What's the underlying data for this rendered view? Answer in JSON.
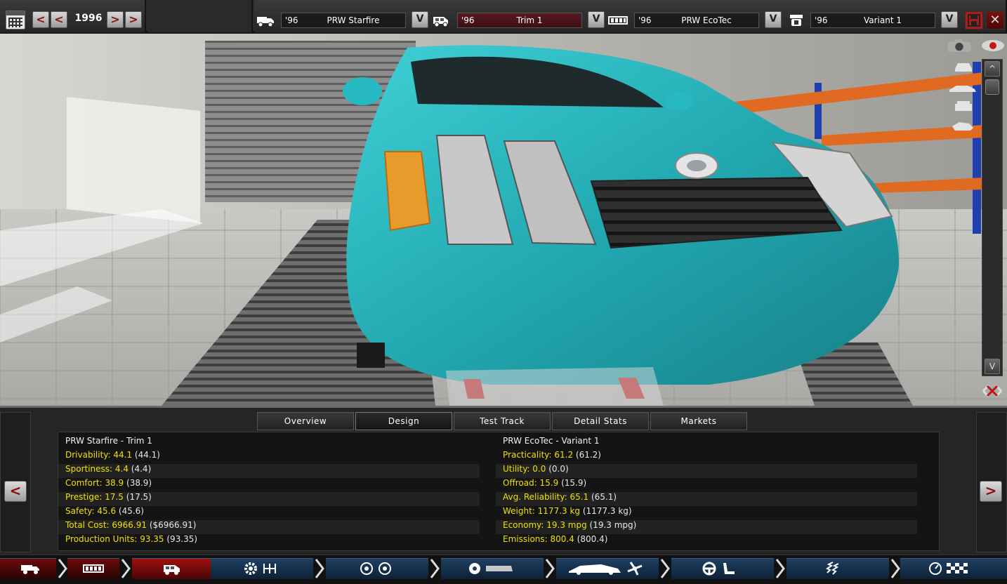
{
  "topbar": {
    "year": "1996",
    "prev_label": "<",
    "next_label": ">",
    "dropdown_label": "V",
    "selectors": [
      {
        "year": "'96",
        "name": "PRW Starfire"
      },
      {
        "year": "'96",
        "name": "Trim 1"
      },
      {
        "year": "'96",
        "name": "PRW EcoTec"
      },
      {
        "year": "'96",
        "name": "Variant 1"
      }
    ],
    "close_label": "✕"
  },
  "viewport": {
    "car_color": "#2ab0b8",
    "scroll_up": "^",
    "scroll_down": "V"
  },
  "tabs": [
    {
      "label": "Overview"
    },
    {
      "label": "Design"
    },
    {
      "label": "Test Track"
    },
    {
      "label": "Detail Stats"
    },
    {
      "label": "Markets"
    }
  ],
  "panel": {
    "prev_label": "<",
    "next_label": ">",
    "left_title": "PRW Starfire - Trim 1",
    "right_title": "PRW EcoTec - Variant 1",
    "left_stats": [
      {
        "label": "Drivability: 44.1",
        "value": " (44.1)"
      },
      {
        "label": "Sportiness: 4.4",
        "value": " (4.4)"
      },
      {
        "label": "Comfort: 38.9",
        "value": " (38.9)"
      },
      {
        "label": "Prestige: 17.5",
        "value": " (17.5)"
      },
      {
        "label": "Safety: 45.6",
        "value": " (45.6)"
      },
      {
        "label": "Total Cost: 6966.91",
        "value": " ($6966.91)"
      },
      {
        "label": "Production Units: 93.35",
        "value": " (93.35)"
      }
    ],
    "right_stats": [
      {
        "label": "Practicality: 61.2",
        "value": " (61.2)"
      },
      {
        "label": "Utility: 0.0",
        "value": " (0.0)"
      },
      {
        "label": "Offroad: 15.9",
        "value": " (15.9)"
      },
      {
        "label": "Avg. Reliability: 65.1",
        "value": " (65.1)"
      },
      {
        "label": "Weight: 1177.3 kg",
        "value": " (1177.3 kg)"
      },
      {
        "label": "Economy: 19.3 mpg",
        "value": " (19.3 mpg)"
      },
      {
        "label": "Emissions: 800.4",
        "value": " (800.4)"
      }
    ]
  },
  "colors": {
    "accent_red": "#b11a1a",
    "stat_label": "#f0e000",
    "nav_blue": "#1e3e60"
  }
}
